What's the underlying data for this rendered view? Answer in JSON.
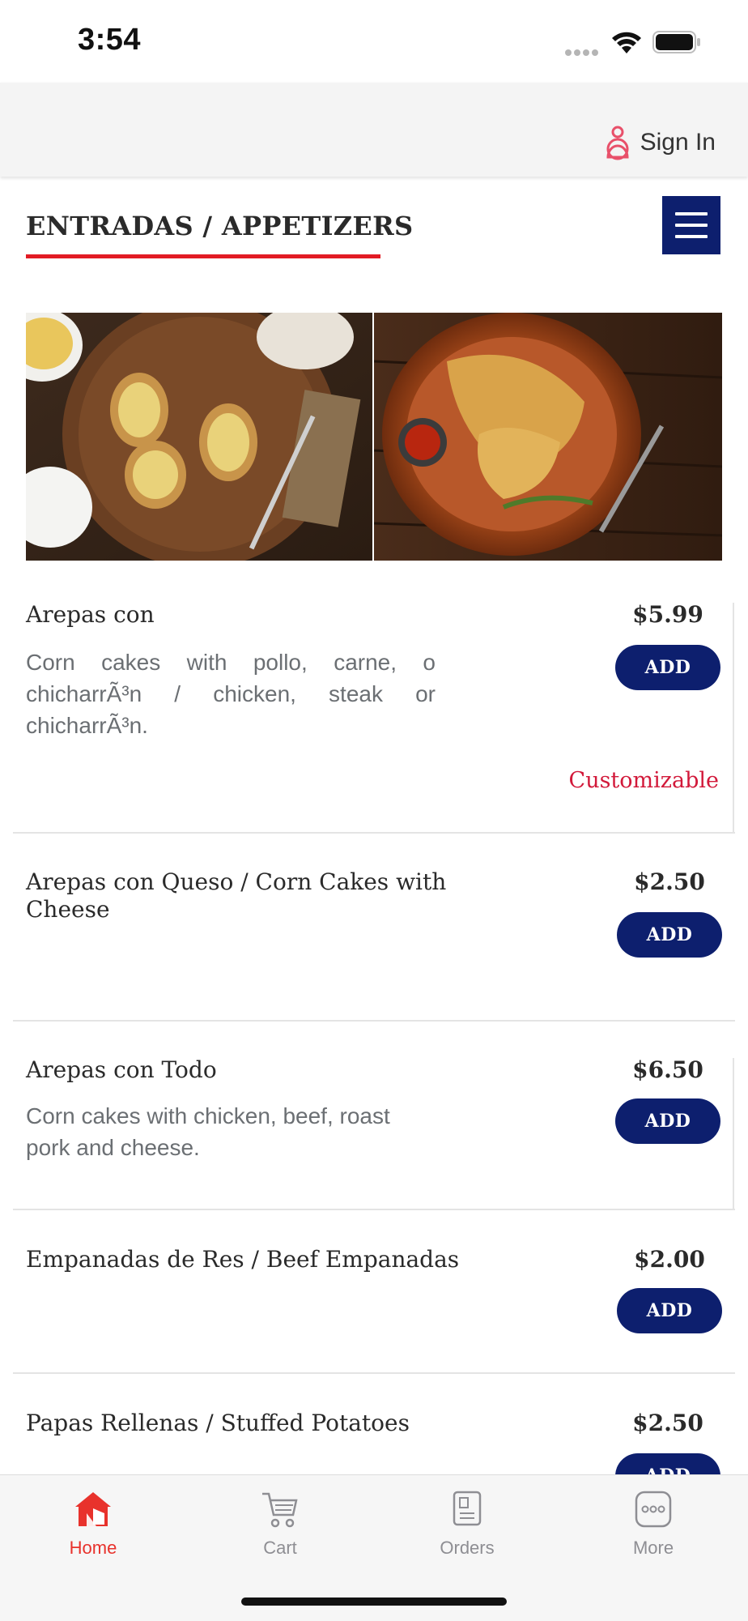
{
  "status_bar": {
    "time": "3:54"
  },
  "header": {
    "sign_in_label": "Sign In"
  },
  "section": {
    "title": "ENTRADAS / APPETIZERS"
  },
  "items": [
    {
      "name": "Arepas con",
      "description": "Corn cakes with pollo, carne, o chicharrÃ³n / chicken, steak or chicharrÃ³n.",
      "price": "$5.99",
      "add_label": "ADD",
      "tag": "Customizable"
    },
    {
      "name": "Arepas con Queso / Corn Cakes with Cheese",
      "description": "",
      "price": "$2.50",
      "add_label": "ADD"
    },
    {
      "name": "Arepas con Todo",
      "description": "Corn cakes with chicken, beef, roast pork and cheese.",
      "price": "$6.50",
      "add_label": "ADD"
    },
    {
      "name": "Empanadas de Res / Beef Empanadas",
      "description": "",
      "price": "$2.00",
      "add_label": "ADD"
    },
    {
      "name": "Papas Rellenas / Stuffed Potatoes",
      "description": "",
      "price": "$2.50",
      "add_label": "ADD"
    }
  ],
  "tabs": [
    {
      "label": "Home",
      "icon": "home-icon",
      "active": true
    },
    {
      "label": "Cart",
      "icon": "cart-icon",
      "active": false
    },
    {
      "label": "Orders",
      "icon": "orders-icon",
      "active": false
    },
    {
      "label": "More",
      "icon": "more-icon",
      "active": false
    }
  ],
  "colors": {
    "accent_navy": "#0d1f6e",
    "accent_red": "#e21b24",
    "tag_red": "#d2193a",
    "active_tab": "#e8322c"
  }
}
